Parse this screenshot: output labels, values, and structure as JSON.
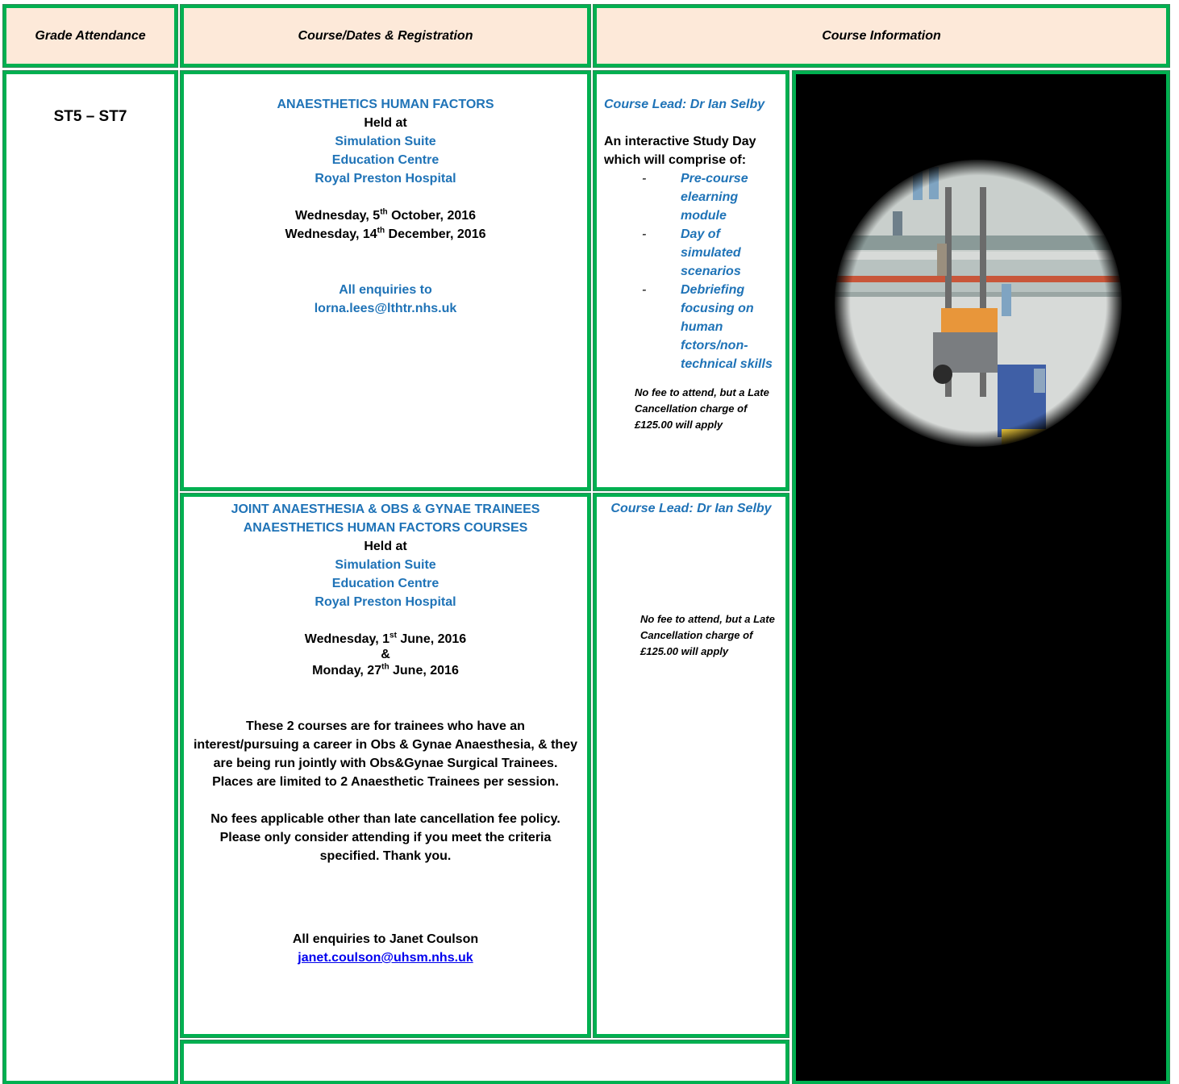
{
  "headers": {
    "grade": "Grade Attendance",
    "course_dates": "Course/Dates & Registration",
    "course_info": "Course Information"
  },
  "grade_value": "ST5 – ST7",
  "course1": {
    "title": "ANAESTHETICS HUMAN FACTORS",
    "held_at": "Held at",
    "venue1": "Simulation Suite",
    "venue2": "Education Centre",
    "venue3": "Royal Preston Hospital",
    "date1_pre": "Wednesday, 5",
    "date1_sup": "th",
    "date1_post": " October, 2016",
    "date2_pre": "Wednesday, 14",
    "date2_sup": "th",
    "date2_post": " December, 2016",
    "enquiries": "All enquiries to",
    "email": "lorna.lees@lthtr.nhs.uk"
  },
  "info1": {
    "lead": "Course Lead:  Dr Ian Selby",
    "intro": "An interactive Study Day which will comprise  of:",
    "items": [
      "Pre-course elearning module",
      "Day of simulated scenarios",
      "Debriefing focusing on human fctors/non-technical skills"
    ],
    "fee": "No fee to attend,  but a Late Cancellation charge of  £125.00 will apply"
  },
  "course2": {
    "title1": "JOINT ANAESTHESIA & OBS & GYNAE TRAINEES",
    "title2": "ANAESTHETICS HUMAN FACTORS COURSES",
    "held_at": "Held at",
    "venue1": "Simulation Suite",
    "venue2": "Education Centre",
    "venue3": "Royal Preston Hospital",
    "date1_pre": "Wednesday, 1",
    "date1_sup": "st",
    "date1_post": " June, 2016",
    "amp": "&",
    "date2_pre": "Monday, 27",
    "date2_sup": "th",
    "date2_post": " June, 2016",
    "para1": "These 2 courses are for trainees who have an interest/pursuing a career in Obs & Gynae Anaesthesia, & they are being run jointly with Obs&Gynae Surgical Trainees. Places are limited to 2 Anaesthetic Trainees per session.",
    "para2": "No fees applicable other than late cancellation fee policy.  Please only consider attending if you meet the criteria specified.  Thank you.",
    "enquiries": "All enquiries to Janet Coulson",
    "email": "janet.coulson@uhsm.nhs.uk"
  },
  "info2": {
    "lead": "Course Lead:  Dr Ian Selby",
    "fee": "No fee to attend,  but a Late Cancellation charge of  £125.00 will apply"
  }
}
